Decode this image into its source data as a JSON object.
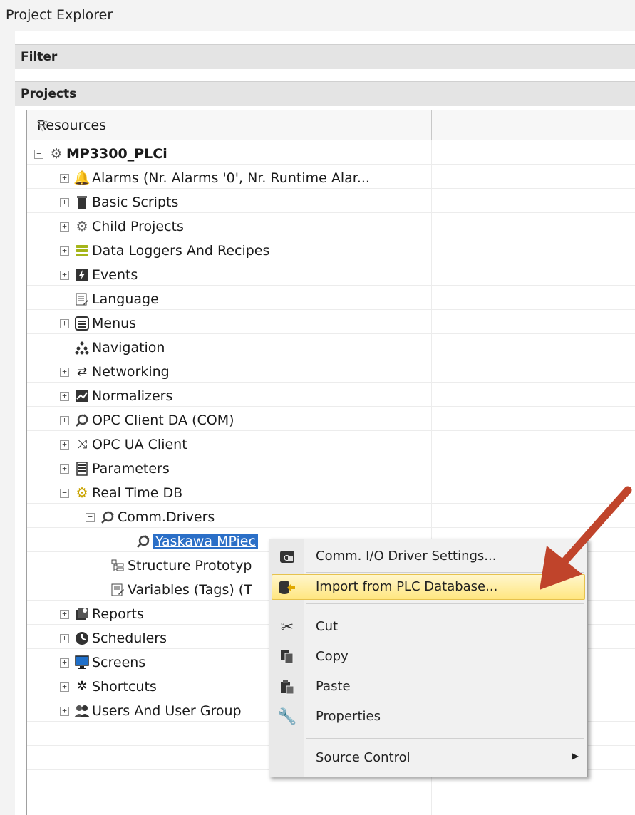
{
  "titlebar": {
    "title": "Project Explorer"
  },
  "sections": {
    "filter": "Filter",
    "projects": "Projects"
  },
  "grid": {
    "column_header": "Resources",
    "filter_glyph": "▽"
  },
  "tree": {
    "root": "MP3300_PLCi",
    "alarms": "Alarms (Nr. Alarms '0', Nr. Runtime Alar...",
    "basic_scripts": "Basic Scripts",
    "child_projects": "Child Projects",
    "data_loggers": "Data Loggers And Recipes",
    "events": "Events",
    "language": "Language",
    "menus": "Menus",
    "navigation": "Navigation",
    "networking": "Networking",
    "normalizers": "Normalizers",
    "opc_da": "OPC Client DA (COM)",
    "opc_ua": "OPC UA Client",
    "parameters": "Parameters",
    "realtime_db": "Real Time DB",
    "comm_drivers": "Comm.Drivers",
    "yaskawa": "Yaskawa MPiec",
    "structure": "Structure Prototyp",
    "variables": "Variables (Tags) (T",
    "reports": "Reports",
    "schedulers": "Schedulers",
    "screens": "Screens",
    "shortcuts": "Shortcuts",
    "users": "Users And User Group"
  },
  "context_menu": {
    "driver_settings": "Comm. I/O Driver Settings...",
    "import_plc": "Import from PLC Database...",
    "cut": "Cut",
    "copy": "Copy",
    "paste": "Paste",
    "properties": "Properties",
    "source_control": "Source Control"
  },
  "colors": {
    "selection": "#2b6fc7",
    "menu_highlight": "#ffe680",
    "annotation_arrow": "#c0442b"
  }
}
